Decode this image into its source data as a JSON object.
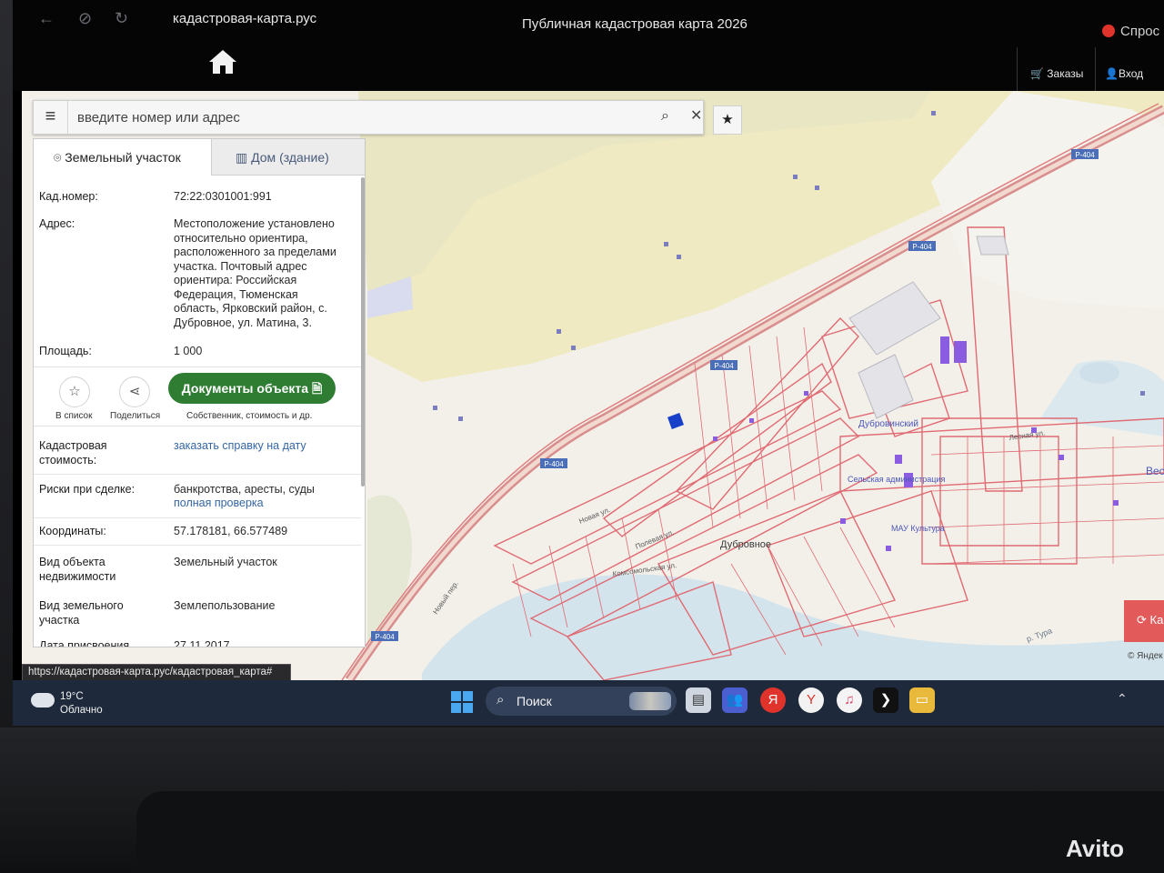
{
  "browser": {
    "url": "кадастровая-карта.рус",
    "tab_title": "Публичная кадастровая карта 2026",
    "ask_label": "Спрос",
    "orders_label": "Заказы",
    "login_label": "Вход"
  },
  "search": {
    "placeholder": "введите номер или адрес"
  },
  "panel": {
    "tab_land": "Земельный участок",
    "tab_house": "Дом (здание)",
    "cad_label": "Кад.номер:",
    "cad_value": "72:22:0301001:991",
    "address_label": "Адрес:",
    "address_lines": [
      "Местоположение установлено",
      "относительно ориентира,",
      "расположенного за пределами",
      "участка. Почтовый адрес",
      "ориентира: Российская",
      "Федерация, Тюменская",
      "область, Ярковский район, с.",
      "Дубровное, ул. Матина, 3."
    ],
    "area_label": "Площадь:",
    "area_value": "1 000",
    "to_list_label": "В список",
    "share_label": "Поделиться",
    "docs_button": "Документы объекта",
    "docs_sub": "Собственник, стоимость и др.",
    "cost_label_1": "Кадастровая",
    "cost_label_2": "стоимость:",
    "cost_link": "заказать справку на дату",
    "risks_label": "Риски при сделке:",
    "risks_value": "банкротства, аресты, суды",
    "risks_link": "полная проверка",
    "coords_label": "Координаты:",
    "coords_value": "57.178181, 66.577489",
    "obj_type_label_1": "Вид объекта",
    "obj_type_label_2": "недвижимости",
    "obj_type_value": "Земельный участок",
    "land_type_label_1": "Вид земельного",
    "land_type_label_2": "участка",
    "land_type_value": "Землепользование",
    "date_label": "Дата присвоения",
    "date_value": "27.11.2017"
  },
  "map": {
    "road_labels": [
      "Р-404",
      "Р-404",
      "Р-404",
      "Р-404",
      "Р-404"
    ],
    "place_labels": [
      "Дубровинский",
      "Сельская администрация",
      "МАУ Культура",
      "Дубровное",
      "Новая ул.",
      "Комсомольская ул.",
      "Полевая ул.",
      "Новый пер.",
      "Весе",
      "р. Тура",
      "Лесная ул."
    ],
    "ka_label": "Ка",
    "credit": "© Яндек"
  },
  "status_url": "https://кадастровая-карта.рус/кадастровая_карта#",
  "taskbar": {
    "temp": "19°C",
    "weather": "Облачно",
    "search_label": "Поиск"
  },
  "watermark": "Avito",
  "colors": {
    "docs_button": "#2f7d32",
    "parcel_stroke": "#e06a72",
    "field_yellow": "#efeac2",
    "river": "#c9dde8",
    "building_purple": "#8a5ce0",
    "selected_parcel": "#1840c8"
  }
}
